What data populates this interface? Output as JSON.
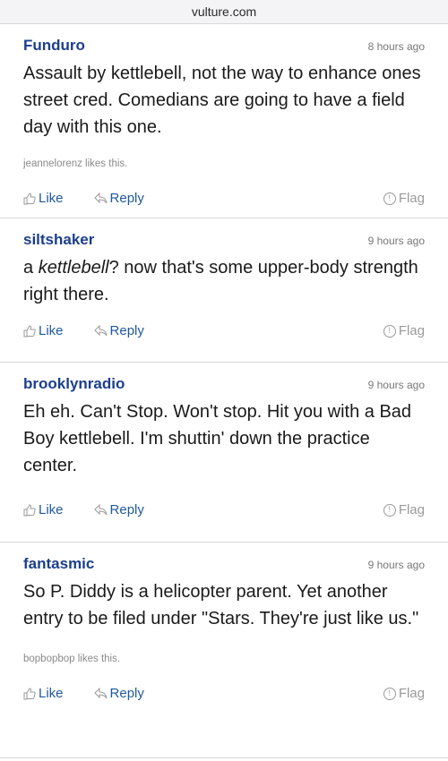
{
  "browser": {
    "url": "vulture.com"
  },
  "comments": [
    {
      "author": "Funduro",
      "time": "8 hours ago",
      "text": "Assault by kettlebell, not the way to enhance ones street cred. Comedians are going to have a field day with this one.",
      "likes": "jeannelorenz likes this."
    },
    {
      "author": "siltshaker",
      "time": "9 hours ago",
      "text_before": "a ",
      "text_em": "kettlebell",
      "text_after": "? now that's some upper-body strength right there."
    },
    {
      "author": "brooklynradio",
      "time": "9 hours ago",
      "text": "Eh eh. Can't Stop. Won't stop. Hit you with a Bad Boy kettlebell. I'm shuttin' down the practice center."
    },
    {
      "author": "fantasmic",
      "time": "9 hours ago",
      "text": "So P. Diddy is a helicopter parent. Yet another entry to be filed under \"Stars. They're just like us.\"",
      "likes": "bopbopbop likes this."
    }
  ],
  "actions": {
    "like": "Like",
    "reply": "Reply",
    "flag": "Flag"
  },
  "colors": {
    "author": "#1c3f8c",
    "action": "#1f5a9c",
    "flag": "#9a9a9a",
    "divider": "#d9d9d9"
  },
  "icons": {
    "like": "thumbs-up-icon",
    "reply": "reply-arrow-icon",
    "flag": "exclamation-circle-icon"
  }
}
